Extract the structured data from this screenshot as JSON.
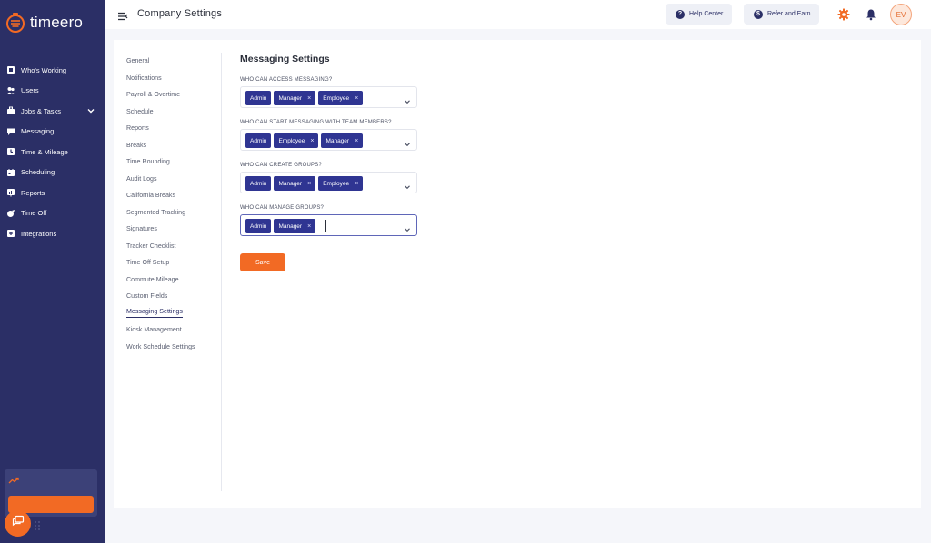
{
  "app": {
    "logo_text": "timeero",
    "colors": {
      "sidebar": "#2b2f66",
      "accent": "#f26a24",
      "chip": "#2f3592"
    }
  },
  "sidebar": {
    "items": [
      {
        "label": "Who's Working",
        "icon": "who-working-icon"
      },
      {
        "label": "Users",
        "icon": "users-icon"
      },
      {
        "label": "Jobs & Tasks",
        "icon": "jobs-tasks-icon",
        "expandable": true
      },
      {
        "label": "Messaging",
        "icon": "messaging-icon"
      },
      {
        "label": "Time & Mileage",
        "icon": "time-mileage-icon"
      },
      {
        "label": "Scheduling",
        "icon": "scheduling-icon"
      },
      {
        "label": "Reports",
        "icon": "reports-icon"
      },
      {
        "label": "Time Off",
        "icon": "time-off-icon"
      },
      {
        "label": "Integrations",
        "icon": "integrations-icon"
      }
    ]
  },
  "header": {
    "title": "Company Settings",
    "help_center": "Help Center",
    "refer_and_earn": "Refer and Earn",
    "avatar_initials": "EV"
  },
  "settings_nav": {
    "items": [
      "General",
      "Notifications",
      "Payroll & Overtime",
      "Schedule",
      "Reports",
      "Breaks",
      "Time Rounding",
      "Audit Logs",
      "California Breaks",
      "Segmented Tracking",
      "Signatures",
      "Tracker Checklist",
      "Time Off Setup",
      "Commute Mileage",
      "Custom Fields",
      "Messaging Settings",
      "Kiosk Management",
      "Work Schedule Settings"
    ],
    "active": "Messaging Settings"
  },
  "messaging": {
    "title": "Messaging Settings",
    "fields": [
      {
        "label": "WHO CAN ACCESS MESSAGING?",
        "chips": [
          {
            "label": "Admin",
            "removable": false
          },
          {
            "label": "Manager",
            "removable": true
          },
          {
            "label": "Employee",
            "removable": true
          }
        ]
      },
      {
        "label": "WHO CAN START MESSAGING WITH TEAM MEMBERS?",
        "chips": [
          {
            "label": "Admin",
            "removable": false
          },
          {
            "label": "Employee",
            "removable": true
          },
          {
            "label": "Manager",
            "removable": true
          }
        ]
      },
      {
        "label": "WHO CAN CREATE GROUPS?",
        "chips": [
          {
            "label": "Admin",
            "removable": false
          },
          {
            "label": "Manager",
            "removable": true
          },
          {
            "label": "Employee",
            "removable": true
          }
        ]
      },
      {
        "label": "WHO CAN MANAGE GROUPS?",
        "chips": [
          {
            "label": "Admin",
            "removable": false
          },
          {
            "label": "Manager",
            "removable": true
          }
        ],
        "focused": true
      }
    ],
    "remove_glyph": "×",
    "save_label": "Save"
  }
}
